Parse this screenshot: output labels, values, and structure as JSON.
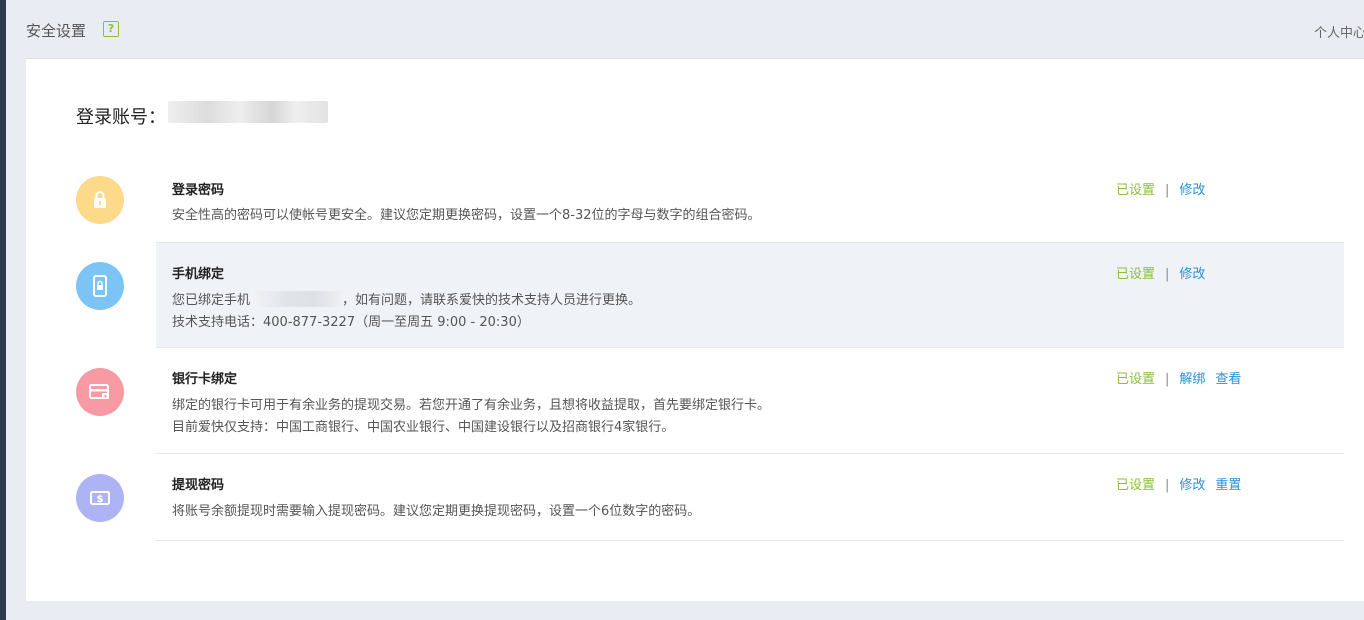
{
  "header": {
    "title": "安全设置",
    "help_label": "?",
    "personal_center": "个人中心"
  },
  "account": {
    "label": "登录账号："
  },
  "items": [
    {
      "title": "登录密码",
      "desc1": "安全性高的密码可以使帐号更安全。建议您定期更换密码，设置一个8-32位的字母与数字的组合密码。",
      "status": "已设置",
      "actions": [
        "修改"
      ],
      "icon": "lock-icon",
      "color": "#fdd98a"
    },
    {
      "title": "手机绑定",
      "desc1_prefix": "您已绑定手机",
      "desc1_suffix": "，如有问题，请联系爱快的技术支持人员进行更换。",
      "desc2": "技术支持电话：400-877-3227（周一至周五 9:00 - 20:30）",
      "status": "已设置",
      "actions": [
        "修改"
      ],
      "icon": "phone-lock-icon",
      "color": "#7cc4f5"
    },
    {
      "title": "银行卡绑定",
      "desc1": "绑定的银行卡可用于有余业务的提现交易。若您开通了有余业务，且想将收益提取，首先要绑定银行卡。",
      "desc2": "目前爱快仅支持：中国工商银行、中国农业银行、中国建设银行以及招商银行4家银行。",
      "status": "已设置",
      "actions": [
        "解绑",
        "查看"
      ],
      "icon": "bank-card-icon",
      "color": "#f79aa3"
    },
    {
      "title": "提现密码",
      "desc1": "将账号余额提现时需要输入提现密码。建议您定期更换提现密码，设置一个6位数字的密码。",
      "status": "已设置",
      "actions": [
        "修改",
        "重置"
      ],
      "icon": "withdraw-money-icon",
      "color": "#aeb3f5"
    }
  ],
  "colors": {
    "status_green": "#8bbf3a",
    "link_blue": "#2a8fd6",
    "sidebar_dark": "#2f3a4f"
  }
}
